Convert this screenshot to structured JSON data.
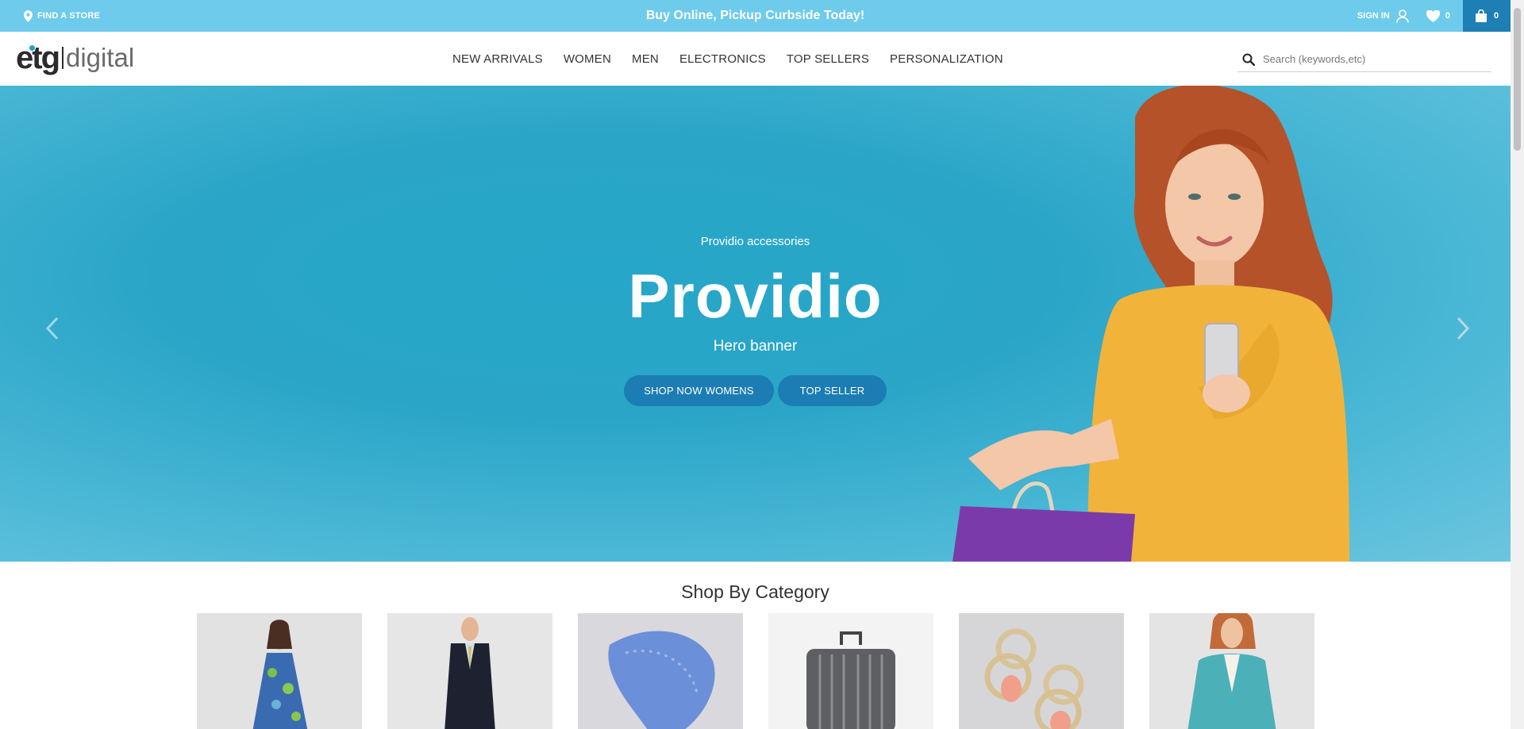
{
  "topbar": {
    "find_store": "FIND A STORE",
    "promo": "Buy Online, Pickup Curbside Today!",
    "sign_in": "SIGN IN",
    "wishlist_count": "0",
    "cart_count": "0"
  },
  "header": {
    "logo_etg": "etg",
    "logo_digital": "digital",
    "nav": [
      "NEW ARRIVALS",
      "WOMEN",
      "MEN",
      "ELECTRONICS",
      "TOP SELLERS",
      "PERSONALIZATION"
    ],
    "search_placeholder": "Search (keywords,etc)"
  },
  "hero": {
    "subtitle": "Providio accessories",
    "title": "Providio",
    "caption": "Hero banner",
    "buttons": [
      "SHOP NOW WOMENS",
      "TOP SELLER"
    ]
  },
  "category": {
    "title": "Shop By Category",
    "items": [
      "dress",
      "suit",
      "tie",
      "luggage",
      "earrings",
      "blazer"
    ]
  },
  "colors": {
    "topbar": "#6ecbec",
    "accent": "#1b7db3",
    "hero": "#2aa5c7"
  }
}
